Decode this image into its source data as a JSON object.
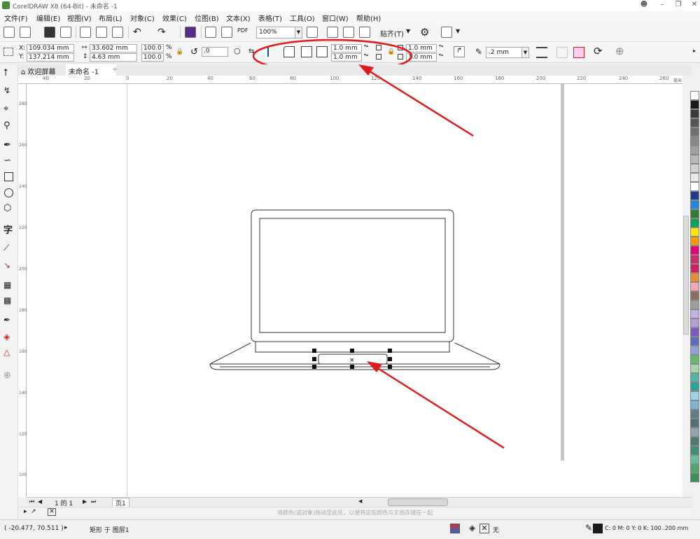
{
  "app": {
    "title": "CorelDRAW X8 (64-Bit) - 未命名 -1"
  },
  "menu": [
    "文件(F)",
    "编辑(E)",
    "视图(V)",
    "布局(L)",
    "对象(C)",
    "效果(C)",
    "位图(B)",
    "文本(X)",
    "表格(T)",
    "工具(O)",
    "窗口(W)",
    "帮助(H)"
  ],
  "toolbar": {
    "zoom": "100%",
    "snap_label": "贴齐(T)",
    "pdf_label": "PDF"
  },
  "properties": {
    "x": "109.034 mm",
    "y": "137.214 mm",
    "w": "33.602 mm",
    "h": "4.63 mm",
    "scale_x": "100.0",
    "scale_y": "100.0",
    "pct": "%",
    "rotation": ".0",
    "corner_top": "1.0 mm",
    "corner_bottom": "1.0 mm",
    "corner_right_top": "1.0 mm",
    "corner_right_bottom": "1.0 mm",
    "outline": ".2 mm",
    "x_label": "X:",
    "y_label": "Y:"
  },
  "tabs": {
    "welcome": "欢迎屏幕",
    "doc": "未命名 -1",
    "add": "+"
  },
  "ruler_top": [
    "40",
    "20",
    "0",
    "20",
    "40",
    "60",
    "80",
    "100",
    "120",
    "140",
    "160",
    "180",
    "200",
    "220",
    "240",
    "260",
    "毫米"
  ],
  "ruler_left": [
    "280",
    "260",
    "240",
    "220",
    "200",
    "180",
    "160",
    "140",
    "120",
    "100",
    "80"
  ],
  "pagenav": {
    "count": "1 的 1",
    "page": "页1"
  },
  "drop_hint": "将颜色(或对象)拖动至此处，以便将这些颜色与文档存储在一起",
  "status": {
    "coords": "( -20.477, 70.511 )",
    "object": "矩形 于 图层1",
    "fill": "无",
    "outline_info": "C: 0 M: 0 Y: 0 K: 100  .200 mm"
  },
  "colors": {
    "annotation": "#e01b1b",
    "palette": [
      "#ffffff",
      "#1a1a1a",
      "#3a3a3a",
      "#555555",
      "#6f6f6f",
      "#888888",
      "#a0a0a0",
      "#b8b8b8",
      "#d0d0d0",
      "#e8e8e8",
      "#ffffff",
      "#1f3a93",
      "#1e88e5",
      "#2e7d32",
      "#00a651",
      "#ffe600",
      "#ff9800",
      "#e6007e",
      "#cc2d6e",
      "#d81b60",
      "#e88e2e",
      "#f4a6b4",
      "#8d6e63",
      "#9e9e9e",
      "#c5b0e6",
      "#b39ddb",
      "#7e57c2",
      "#5c6bc0",
      "#8fa4d6",
      "#66bb6a",
      "#a5d6a7",
      "#4db6ac",
      "#26a69a",
      "#9dd4e8",
      "#82b1d8",
      "#607d8b",
      "#546e7a",
      "#90a4ae",
      "#4e7a6e",
      "#3e8e7a",
      "#6abe9e",
      "#52a56f",
      "#3d8f5a"
    ]
  }
}
